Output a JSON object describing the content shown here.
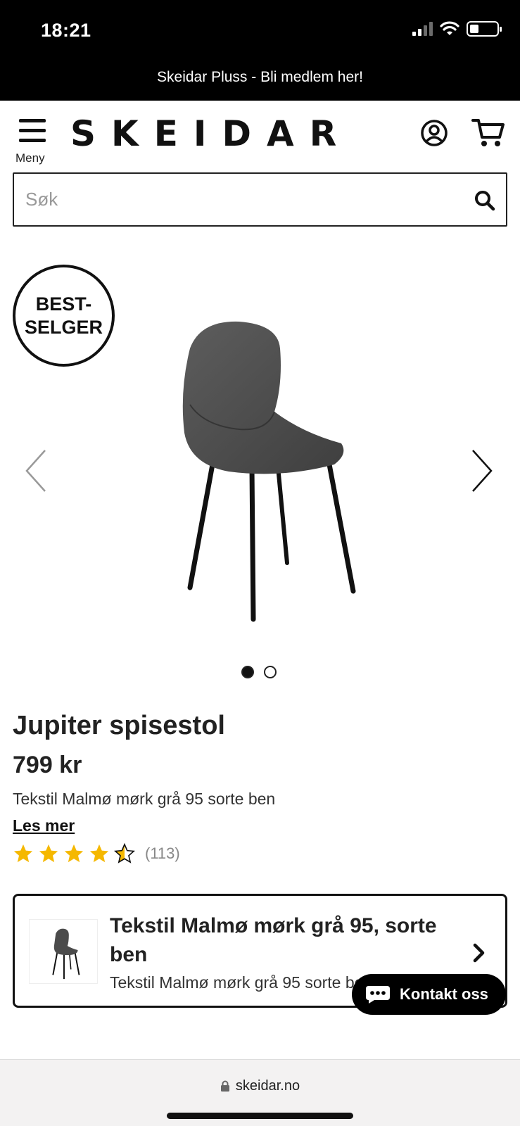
{
  "status_bar": {
    "time": "18:21"
  },
  "promo_banner": {
    "text": "Skeidar Pluss - Bli medlem her!"
  },
  "header": {
    "menu_label": "Meny",
    "logo": "SKEIDAR",
    "icons": [
      "menu-icon",
      "account-icon",
      "cart-icon"
    ]
  },
  "search": {
    "placeholder": "Søk",
    "value": ""
  },
  "gallery": {
    "badge_line1": "BEST-",
    "badge_line2": "SELGER",
    "image_count": 2,
    "active_index": 0
  },
  "product": {
    "title": "Jupiter spisestol",
    "price": "799 kr",
    "variant": "Tekstil Malmø mørk grå 95 sorte ben",
    "read_more": "Les mer",
    "rating": 4.5,
    "review_count": "(113)"
  },
  "variant_card": {
    "title": "Tekstil Malmø mørk grå 95, sorte ben",
    "subtitle": "Tekstil Malmø mørk grå 95 sorte ben"
  },
  "chat": {
    "label": "Kontakt oss"
  },
  "browser": {
    "url": "skeidar.no"
  },
  "colors": {
    "star": "#f5b800",
    "banner_bg": "#000000",
    "text": "#222222"
  }
}
